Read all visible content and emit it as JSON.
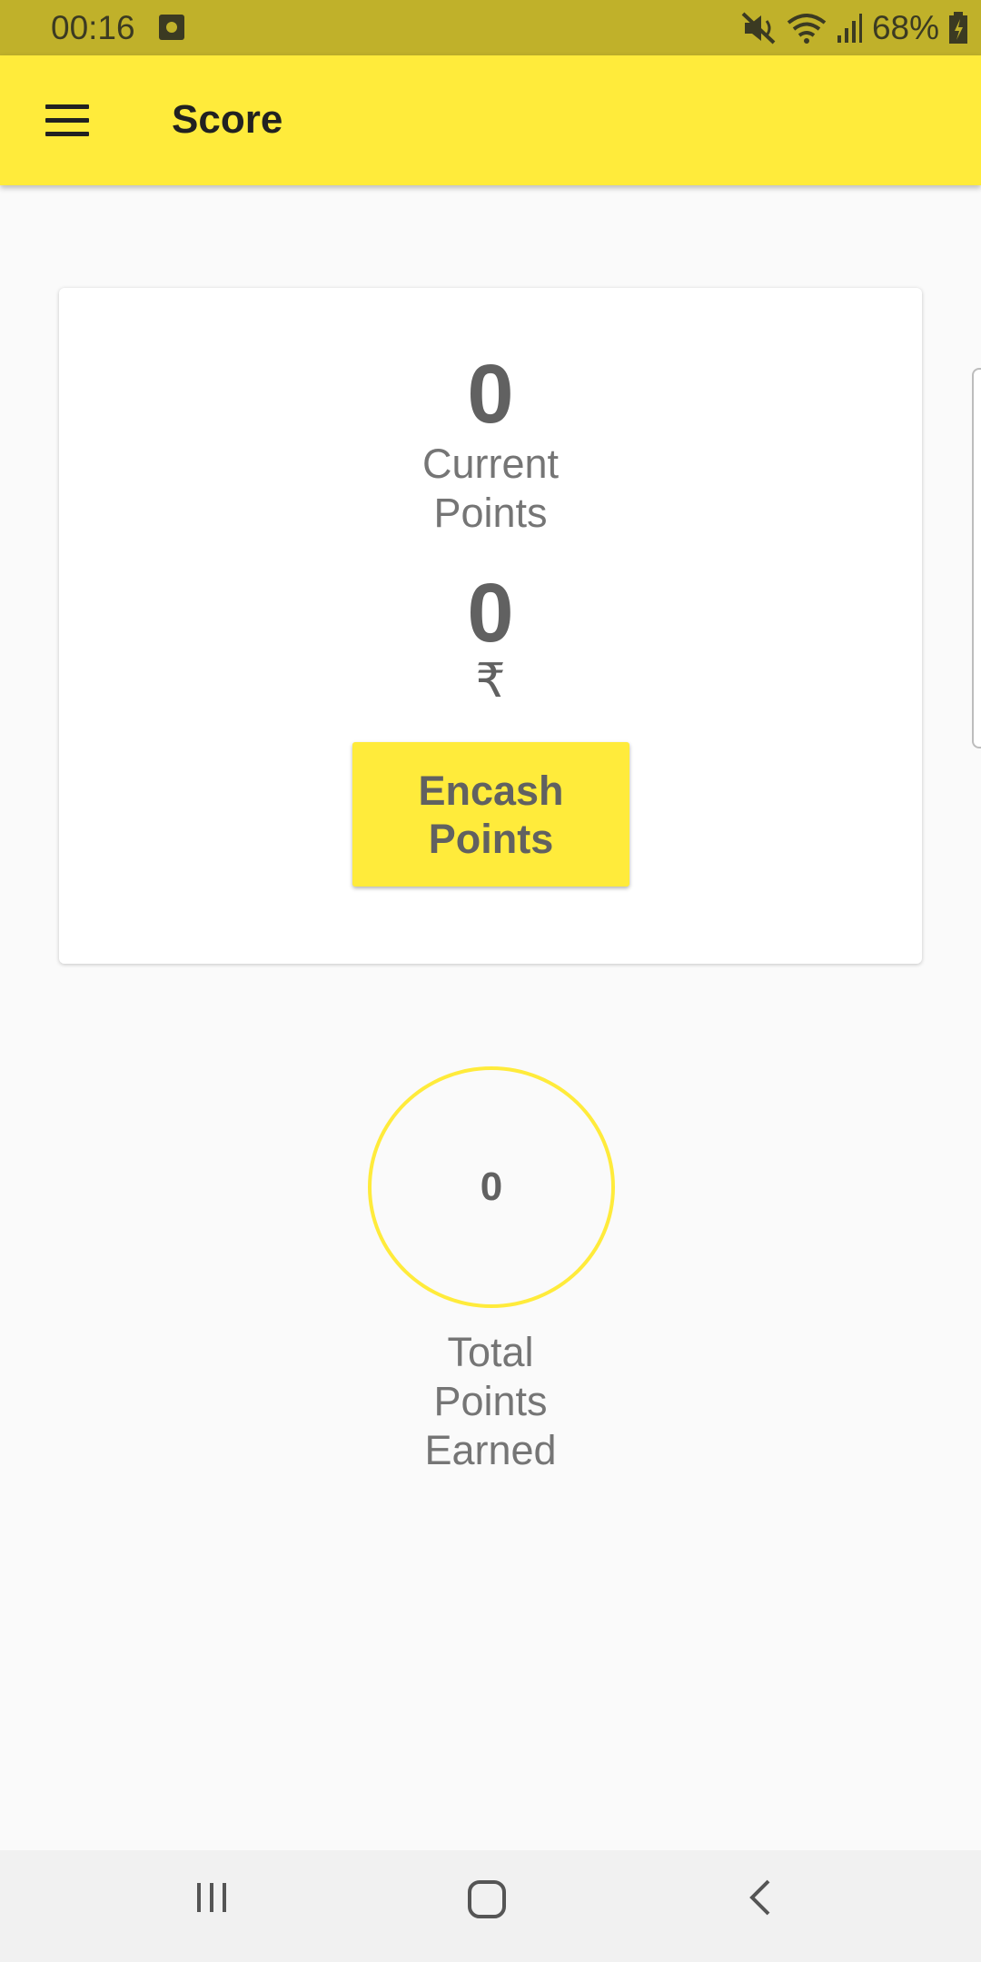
{
  "status_bar": {
    "time": "00:16",
    "battery": "68%",
    "icons": [
      "notification-icon",
      "mute-icon",
      "wifi-icon",
      "signal-icon",
      "battery-icon"
    ]
  },
  "app_bar": {
    "title": "Score",
    "menu_icon": "hamburger-menu-icon",
    "color": "#ffeb3b"
  },
  "score_card": {
    "current_points_value": "0",
    "current_points_label_line1": "Current",
    "current_points_label_line2": "Points",
    "rupee_value": "0",
    "rupee_symbol": "₹",
    "encash_button_line1": "Encash",
    "encash_button_line2": "Points"
  },
  "total": {
    "value": "0",
    "label_line1": "Total",
    "label_line2": "Points",
    "label_line3": "Earned"
  },
  "nav_bar": {
    "icons": [
      "recent-apps-icon",
      "home-icon",
      "back-icon"
    ]
  }
}
